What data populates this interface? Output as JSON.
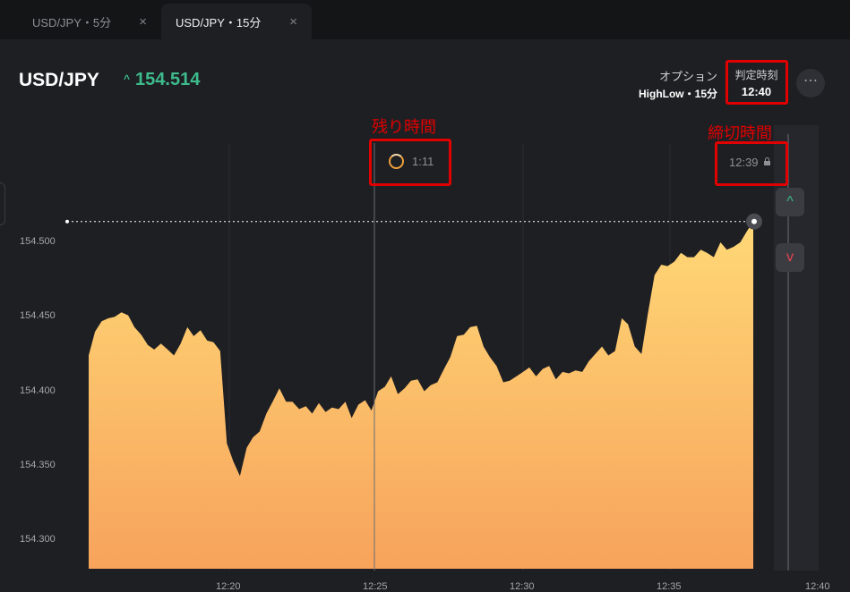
{
  "tabs": [
    {
      "label": "USD/JPY・5分",
      "close": "×"
    },
    {
      "label": "USD/JPY・15分",
      "close": "×"
    }
  ],
  "header": {
    "pair": "USD/JPY",
    "price": "154.514",
    "price_arrow": "^",
    "option_label": "オプション",
    "option_value": "HighLow・15分",
    "judge_label": "判定時刻",
    "judge_time": "12:40",
    "more": "⋯"
  },
  "annotations": {
    "remaining": "残り時間",
    "deadline": "締切時間"
  },
  "timer": {
    "remaining": "1:11"
  },
  "expiry": {
    "time": "12:39"
  },
  "buttons": {
    "high": "^",
    "low": "v"
  },
  "colors": {
    "up": "#3dbb8c",
    "down": "#e6434d",
    "annotation": "#e10000",
    "area_top": "#ffd876",
    "area_bottom": "#f7a35c"
  },
  "chart_data": {
    "type": "area",
    "y_ticks": [
      "154.500",
      "154.450",
      "154.400",
      "154.350",
      "154.300"
    ],
    "x_ticks": [
      "12:20",
      "12:25",
      "12:30",
      "12:35",
      "12:40"
    ],
    "current_price": 154.514,
    "ylim": [
      154.28,
      154.54
    ],
    "series": [
      {
        "x": [
          12.167,
          12.183,
          12.2,
          12.217,
          12.233,
          12.25,
          12.267,
          12.283,
          12.3,
          12.317,
          12.333,
          12.35,
          12.367,
          12.383,
          12.4,
          12.417,
          12.433,
          12.45,
          12.467,
          12.483,
          12.5,
          12.517,
          12.533,
          12.55,
          12.567,
          12.583,
          12.6,
          12.617,
          12.633,
          12.65,
          12.667,
          12.683,
          12.7,
          12.717,
          12.733,
          12.75,
          12.767,
          12.783,
          12.8,
          12.817,
          12.833,
          12.85,
          12.867,
          12.883,
          12.9,
          12.917,
          12.933,
          12.95,
          12.967,
          12.983,
          13.0,
          13.017,
          13.033,
          13.05,
          13.067,
          13.083,
          13.1,
          13.117,
          13.133,
          13.15,
          13.167,
          13.183,
          13.2,
          13.217,
          13.233,
          13.25,
          13.267,
          13.283,
          13.3,
          13.317,
          13.333,
          13.35,
          13.367,
          13.383,
          13.4,
          13.417,
          13.433,
          13.45,
          13.467,
          13.483,
          13.5,
          13.517,
          13.533,
          13.55,
          13.567,
          13.583,
          13.6,
          13.617,
          13.633,
          13.65,
          13.667,
          13.683,
          13.7,
          13.717,
          13.733,
          13.75,
          13.767,
          13.783,
          13.8,
          13.817,
          13.833,
          13.85
        ],
        "y": [
          154.424,
          154.44,
          154.447,
          154.449,
          154.45,
          154.453,
          154.451,
          154.443,
          154.438,
          154.431,
          154.428,
          154.432,
          154.428,
          154.424,
          154.432,
          154.443,
          154.437,
          154.441,
          154.434,
          154.433,
          154.427,
          154.365,
          154.353,
          154.343,
          154.362,
          154.369,
          154.373,
          154.385,
          154.393,
          154.402,
          154.393,
          154.393,
          154.388,
          154.39,
          154.385,
          154.392,
          154.386,
          154.389,
          154.388,
          154.393,
          154.382,
          154.391,
          154.394,
          154.387,
          154.4,
          154.403,
          154.41,
          154.398,
          154.402,
          154.407,
          154.408,
          154.4,
          154.404,
          154.406,
          154.415,
          154.423,
          154.437,
          154.438,
          154.443,
          154.444,
          154.43,
          154.423,
          154.417,
          154.406,
          154.407,
          154.41,
          154.413,
          154.416,
          154.41,
          154.415,
          154.417,
          154.408,
          154.413,
          154.412,
          154.414,
          154.413,
          154.42,
          154.425,
          154.43,
          154.424,
          154.427,
          154.449,
          154.445,
          154.43,
          154.425,
          154.452,
          154.478,
          154.485,
          154.484,
          154.487,
          154.493,
          154.49,
          154.49,
          154.495,
          154.493,
          154.49,
          154.5,
          154.495,
          154.497,
          154.5,
          154.507,
          154.514
        ]
      }
    ]
  }
}
